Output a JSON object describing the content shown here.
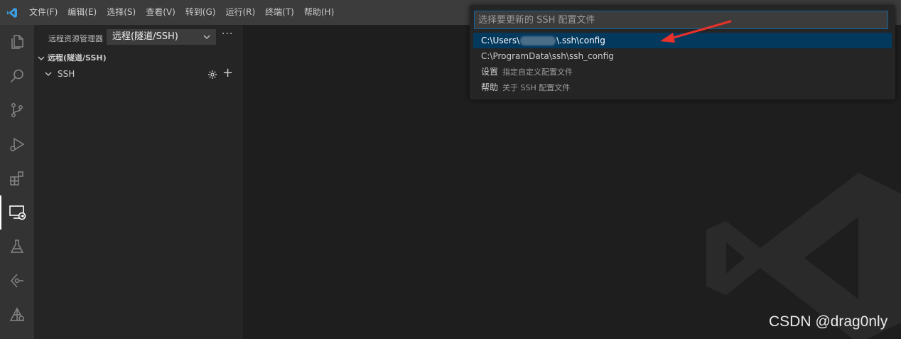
{
  "menu": [
    "文件(F)",
    "编辑(E)",
    "选择(S)",
    "查看(V)",
    "转到(G)",
    "运行(R)",
    "终端(T)",
    "帮助(H)"
  ],
  "activity_bar": [
    "explorer-icon",
    "search-icon",
    "source-control-icon",
    "run-debug-icon",
    "extensions-icon",
    "remote-explorer-icon",
    "testing-icon",
    "git-graph-icon",
    "remote-deploy-icon"
  ],
  "sidebar": {
    "title": "远程资源管理器",
    "select_value": "远程(隧道/SSH)",
    "more": "···",
    "section": "远程(隧道/SSH)",
    "tree_item": "SSH"
  },
  "quick_pick": {
    "placeholder": "选择要更新的 SSH 配置文件",
    "items": [
      {
        "prefix": "C:\\Users\\",
        "suffix": "\\.ssh\\config"
      },
      {
        "label": "C:\\ProgramData\\ssh\\ssh_config"
      },
      {
        "label": "设置",
        "desc": "指定自定义配置文件"
      },
      {
        "label": "帮助",
        "desc": "关于 SSH 配置文件"
      }
    ]
  },
  "watermark": "CSDN @drag0nly",
  "colors": {
    "accent": "#0e639c",
    "selection": "#04395e",
    "annotation_arrow": "#e8312b"
  }
}
